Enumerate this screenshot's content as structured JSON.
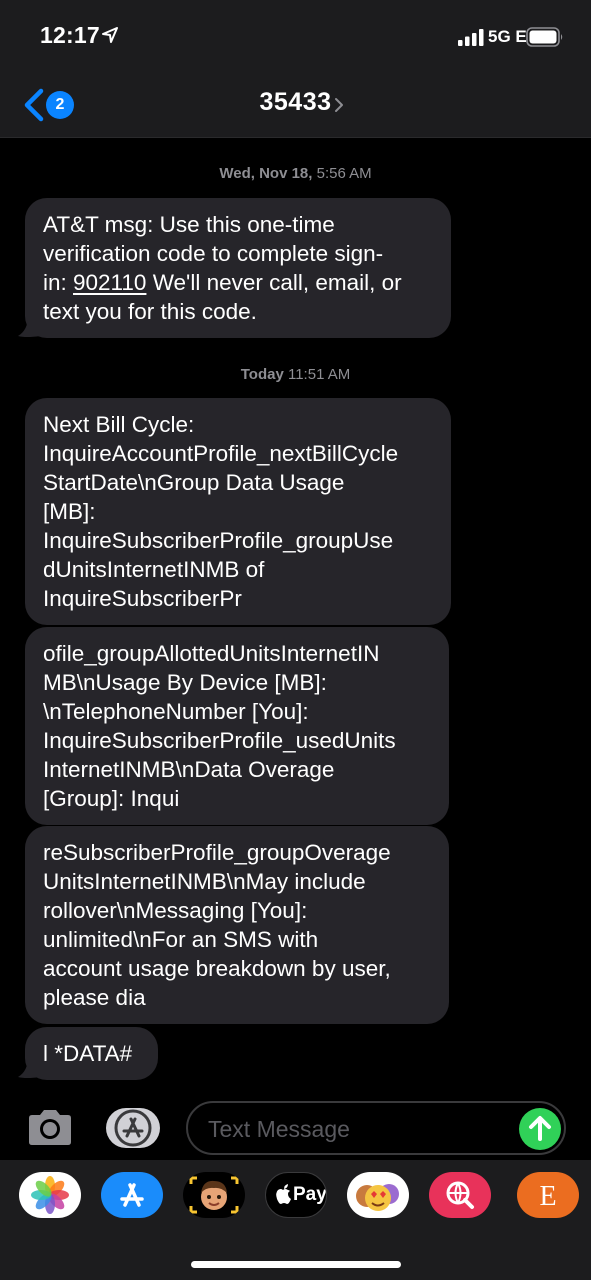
{
  "status_bar": {
    "time": "12:17",
    "network": "5G E"
  },
  "nav": {
    "back_badge": "2",
    "title": "35433"
  },
  "conversation": {
    "timestamps": [
      {
        "day": "Wed, Nov 18,",
        "time": "5:56 AM"
      },
      {
        "day": "Today",
        "time": "11:51 AM"
      }
    ],
    "messages": [
      {
        "lines": [
          "AT&T msg: Use this one-time",
          "verification code to complete sign-",
          "in: ",
          "text you for this code."
        ],
        "code": "902110",
        "after_code": " We'll never call, email, or"
      },
      {
        "lines": [
          "Next Bill Cycle:",
          "InquireAccountProfile_nextBillCycle",
          "StartDate\\nGroup Data Usage",
          "[MB]:",
          "InquireSubscriberProfile_groupUse",
          "dUnitsInternetINMB of",
          "InquireSubscriberPr"
        ]
      },
      {
        "lines": [
          "ofile_groupAllottedUnitsInternetIN",
          "MB\\nUsage By Device [MB]:",
          "\\nTelephoneNumber [You]:",
          "InquireSubscriberProfile_usedUnits",
          "InternetINMB\\nData Overage",
          "[Group]: Inqui"
        ]
      },
      {
        "lines": [
          "reSubscriberProfile_groupOverage",
          "UnitsInternetINMB\\nMay include",
          "rollover\\nMessaging [You]:",
          "unlimited\\nFor an SMS with",
          "account usage breakdown by user,",
          "please dia"
        ]
      },
      {
        "lines": [
          "l *DATA#"
        ]
      }
    ]
  },
  "input": {
    "placeholder": "Text Message"
  },
  "app_drawer": {
    "apps": [
      "photos-app",
      "app-store-app",
      "memoji-stickers-app",
      "apple-pay-app",
      "animoji-app",
      "web-search-app",
      "etsy-app"
    ],
    "etsy_letter": "E",
    "pay_label": "Pay"
  },
  "colors": {
    "accent": "#0a84ff",
    "bubble": "#26252a",
    "send": "#30d158"
  }
}
